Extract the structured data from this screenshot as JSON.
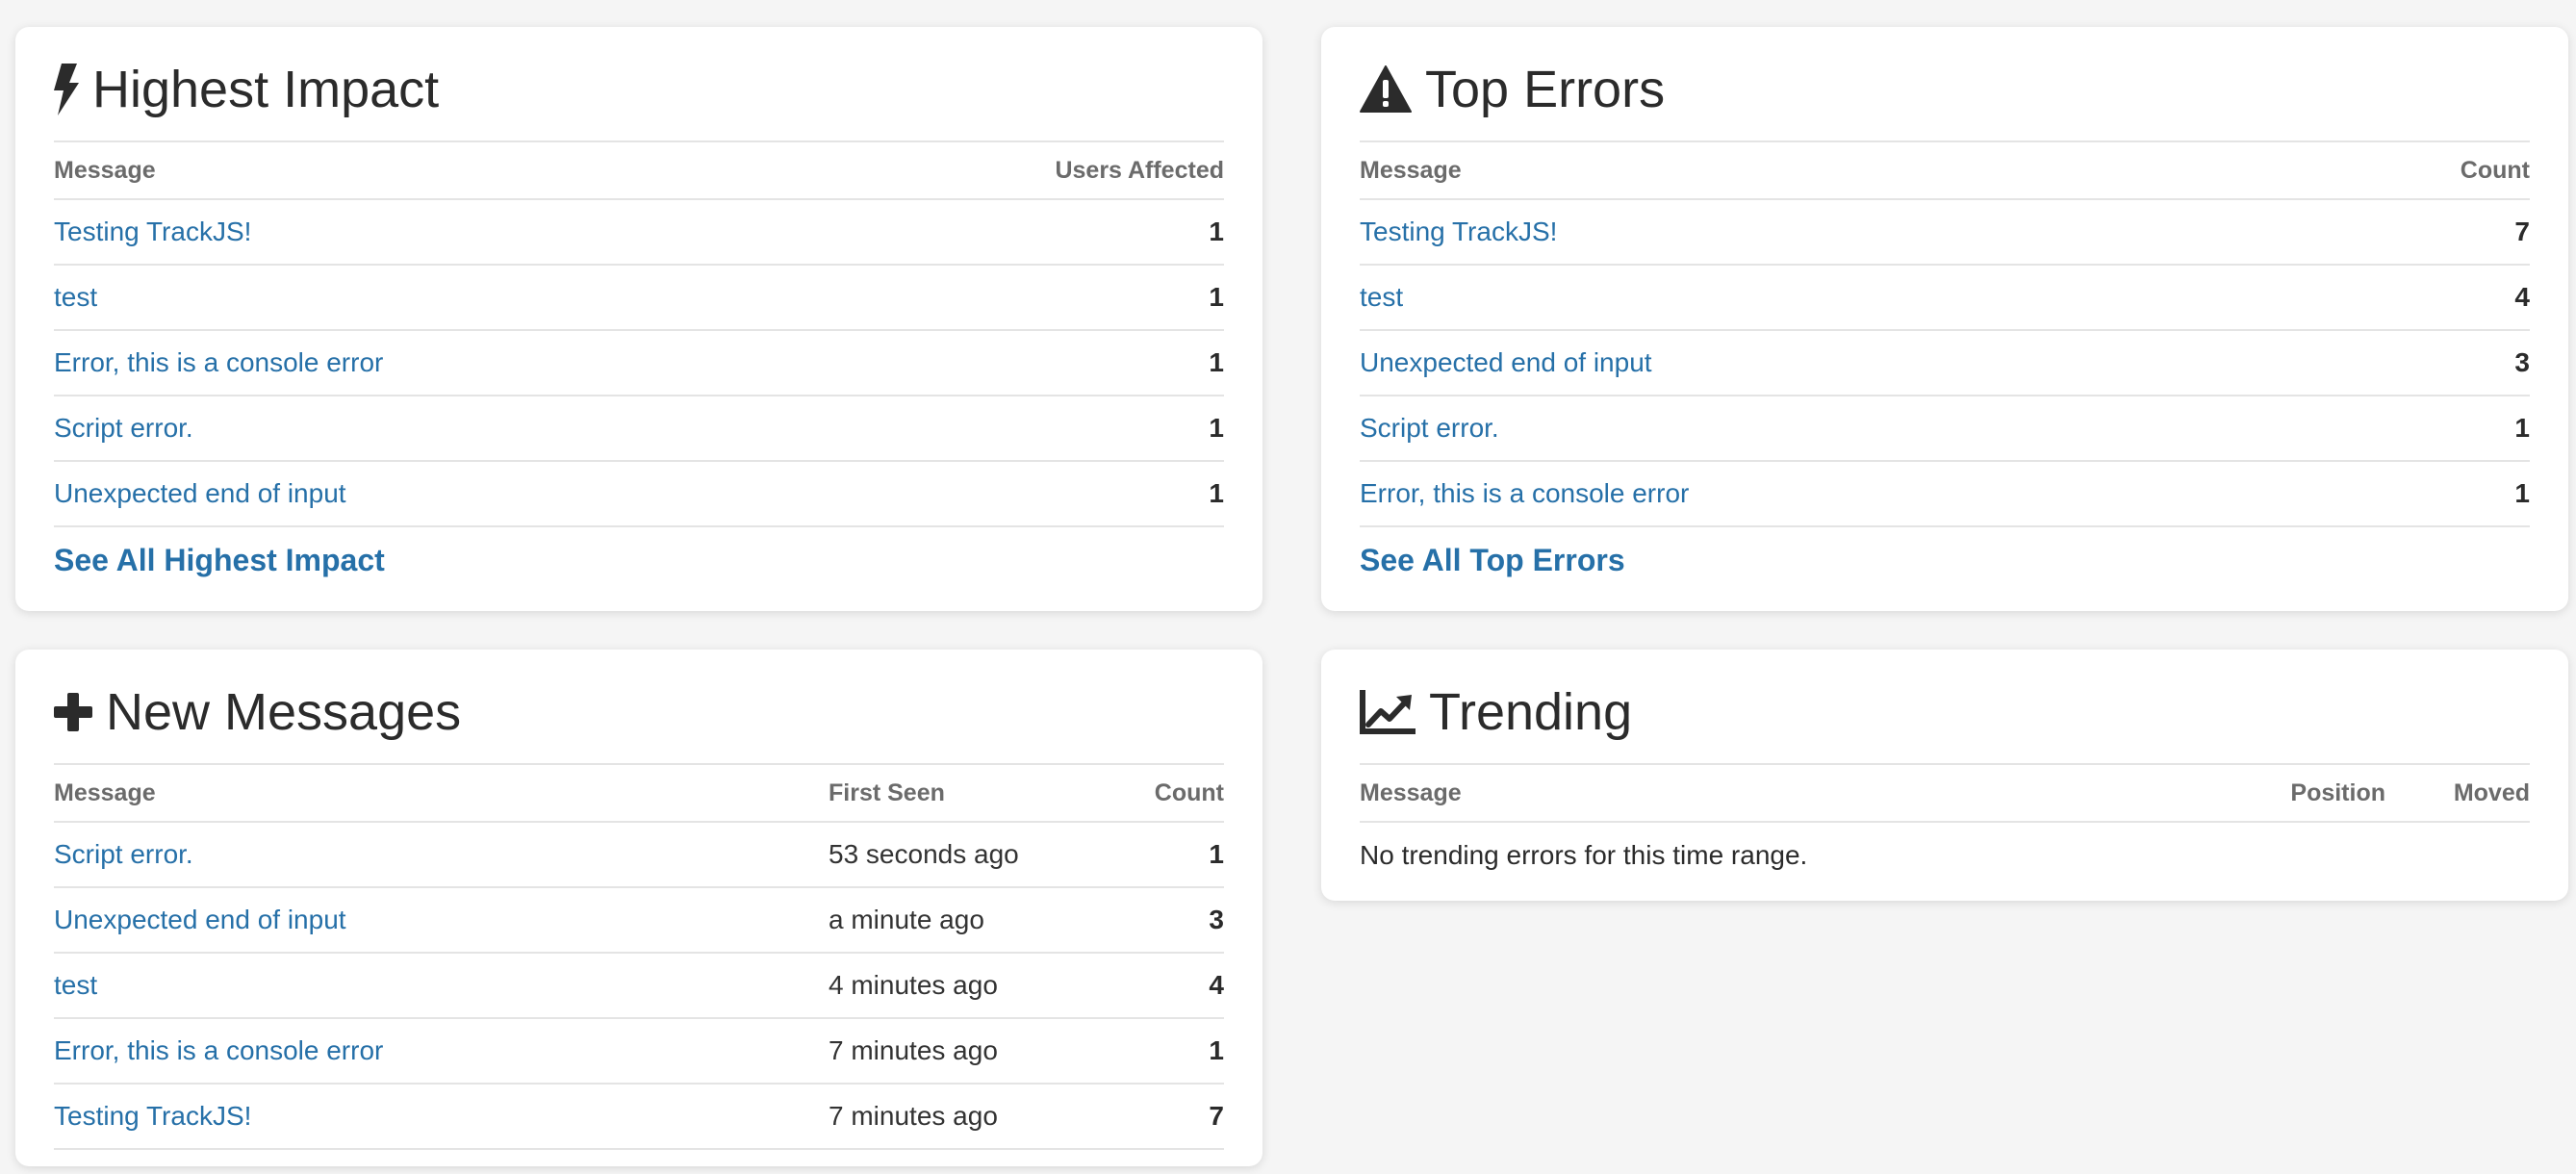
{
  "highest_impact": {
    "title": "Highest Impact",
    "icon": "bolt-icon",
    "columns": [
      "Message",
      "Users Affected"
    ],
    "rows": [
      {
        "message": "Testing TrackJS!",
        "value": "1"
      },
      {
        "message": "test",
        "value": "1"
      },
      {
        "message": "Error, this is a console error",
        "value": "1"
      },
      {
        "message": "Script error.",
        "value": "1"
      },
      {
        "message": "Unexpected end of input",
        "value": "1"
      }
    ],
    "see_all": "See All Highest Impact"
  },
  "top_errors": {
    "title": "Top Errors",
    "icon": "warning-triangle-icon",
    "columns": [
      "Message",
      "Count"
    ],
    "rows": [
      {
        "message": "Testing TrackJS!",
        "value": "7"
      },
      {
        "message": "test",
        "value": "4"
      },
      {
        "message": "Unexpected end of input",
        "value": "3"
      },
      {
        "message": "Script error.",
        "value": "1"
      },
      {
        "message": "Error, this is a console error",
        "value": "1"
      }
    ],
    "see_all": "See All Top Errors"
  },
  "new_messages": {
    "title": "New Messages",
    "icon": "plus-icon",
    "columns": [
      "Message",
      "First Seen",
      "Count"
    ],
    "rows": [
      {
        "message": "Script error.",
        "first_seen": "53 seconds ago",
        "value": "1"
      },
      {
        "message": "Unexpected end of input",
        "first_seen": "a minute ago",
        "value": "3"
      },
      {
        "message": "test",
        "first_seen": "4 minutes ago",
        "value": "4"
      },
      {
        "message": "Error, this is a console error",
        "first_seen": "7 minutes ago",
        "value": "1"
      },
      {
        "message": "Testing TrackJS!",
        "first_seen": "7 minutes ago",
        "value": "7"
      }
    ]
  },
  "trending": {
    "title": "Trending",
    "icon": "line-chart-icon",
    "columns": [
      "Message",
      "Position",
      "Moved"
    ],
    "empty_text": "No trending errors for this time range."
  },
  "colors": {
    "link": "#2670a8",
    "heading": "#2b2b2b",
    "column_header": "#6b6b6b",
    "divider": "#e4e4e4",
    "card_bg": "#ffffff",
    "page_bg": "#f5f5f5"
  }
}
